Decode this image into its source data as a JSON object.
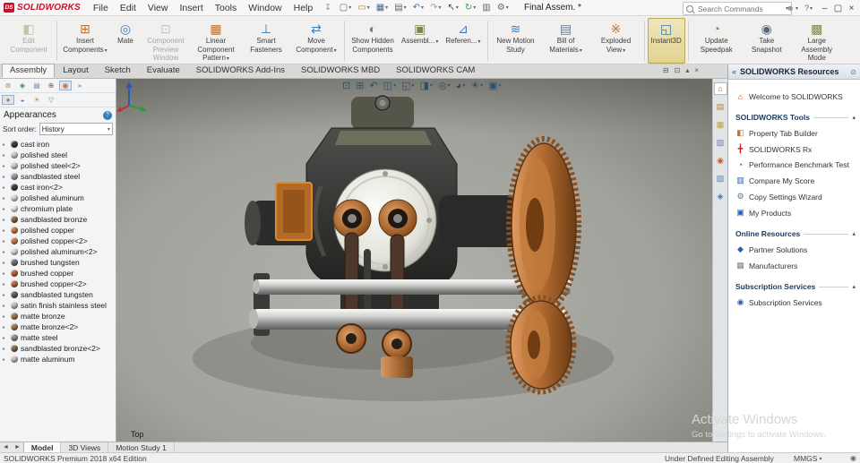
{
  "app": {
    "name": "SOLIDWORKS",
    "logo_mark": "DS",
    "document_title": "Final Assem. *"
  },
  "titlebar": {
    "menus": [
      "File",
      "Edit",
      "View",
      "Insert",
      "Tools",
      "Window",
      "Help"
    ],
    "pin_glyph": "↧",
    "quick_tools": [
      {
        "name": "new-document-icon",
        "glyph": "▢",
        "color": "#5a6a7a",
        "dropdown": true
      },
      {
        "name": "open-icon",
        "glyph": "▭",
        "color": "#b08838",
        "dropdown": true
      },
      {
        "name": "save-icon",
        "glyph": "▦",
        "color": "#4a6a9a",
        "dropdown": true
      },
      {
        "name": "print-icon",
        "glyph": "▤",
        "color": "#5a6a7a",
        "dropdown": true
      },
      {
        "name": "undo-icon",
        "glyph": "↶",
        "color": "#3a7ab8",
        "dropdown": true
      },
      {
        "name": "redo-icon",
        "glyph": "↷",
        "color": "#9aa0a6",
        "dropdown": true
      },
      {
        "name": "select-icon",
        "glyph": "↖",
        "color": "#444444",
        "dropdown": true
      },
      {
        "name": "rebuild-icon",
        "glyph": "↻",
        "color": "#3a9a4a",
        "dropdown": true
      },
      {
        "name": "file-properties-icon",
        "glyph": "▥",
        "color": "#5a6a7a"
      },
      {
        "name": "options-icon",
        "glyph": "⚙",
        "color": "#5a6a7a",
        "dropdown": true
      }
    ],
    "search": {
      "placeholder": "Search Commands"
    },
    "right_icons": [
      {
        "name": "user-icon",
        "glyph": "☻",
        "color": "#8a93a0",
        "dropdown": true
      },
      {
        "name": "help-icon",
        "glyph": "?",
        "color": "#3a7ab8",
        "dropdown": true
      }
    ],
    "window_controls": [
      {
        "name": "minimize-button",
        "glyph": "–"
      },
      {
        "name": "maximize-button",
        "glyph": "▢"
      },
      {
        "name": "close-button",
        "glyph": "×"
      }
    ]
  },
  "ribbon": {
    "buttons": [
      {
        "name": "edit-component-button",
        "icon": "edit-component-icon",
        "label": "Edit Component",
        "glyph": "◧",
        "color": "#7a8a4a",
        "disabled": true,
        "sep_after": true
      },
      {
        "name": "insert-components-button",
        "icon": "insert-components-icon",
        "label": "Insert Components",
        "glyph": "⊞",
        "color": "#b87333",
        "dropdown": true
      },
      {
        "name": "mate-button",
        "icon": "mate-icon",
        "label": "Mate",
        "glyph": "◎",
        "color": "#3a7ab8"
      },
      {
        "name": "component-preview-window-button",
        "icon": "component-preview-window-icon",
        "label": "Component Preview Window",
        "glyph": "⊡",
        "color": "#8a8a8a",
        "disabled": true
      },
      {
        "name": "linear-component-pattern-button",
        "icon": "linear-component-pattern-icon",
        "label": "Linear Component Pattern",
        "glyph": "▦",
        "color": "#b87333",
        "dropdown": true
      },
      {
        "name": "smart-fasteners-button",
        "icon": "smart-fasteners-icon",
        "label": "Smart Fasteners",
        "glyph": "⊥",
        "color": "#3a7ab8"
      },
      {
        "name": "move-component-button",
        "icon": "move-component-icon",
        "label": "Move Component",
        "glyph": "⇄",
        "color": "#3a7ab8",
        "dropdown": true,
        "sep_after": true
      },
      {
        "name": "show-hidden-components-button",
        "icon": "show-hidden-components-icon",
        "label": "Show Hidden Components",
        "glyph": "◐",
        "color": "#6a7a8a"
      },
      {
        "name": "assembly-features-button",
        "icon": "assembly-features-icon",
        "label": "Assembl...",
        "glyph": "▣",
        "color": "#7a8a4a",
        "dropdown": true
      },
      {
        "name": "reference-geometry-button",
        "icon": "reference-geometry-icon",
        "label": "Referen...",
        "glyph": "⊿",
        "color": "#3a7ab8",
        "dropdown": true,
        "sep_after": true
      },
      {
        "name": "new-motion-study-button",
        "icon": "new-motion-study-icon",
        "label": "New Motion Study",
        "glyph": "≋",
        "color": "#3a7ab8"
      },
      {
        "name": "bill-of-materials-button",
        "icon": "bill-of-materials-icon",
        "label": "Bill of Materials",
        "glyph": "▤",
        "color": "#6a7a8a",
        "dropdown": true
      },
      {
        "name": "exploded-view-button",
        "icon": "exploded-view-icon",
        "label": "Exploded View",
        "glyph": "※",
        "color": "#b87333",
        "dropdown": true,
        "sep_after": true
      },
      {
        "name": "instant3d-button",
        "icon": "instant3d-icon",
        "label": "Instant3D",
        "glyph": "◱",
        "color": "#3a7ab8",
        "highlighted": true,
        "sep_after": true
      },
      {
        "name": "update-speedpak-button",
        "icon": "update-speedpak-icon",
        "label": "Update Speedpak",
        "glyph": "◔",
        "color": "#8a8a6a"
      },
      {
        "name": "take-snapshot-button",
        "icon": "take-snapshot-icon",
        "label": "Take Snapshot",
        "glyph": "◉",
        "color": "#556677"
      },
      {
        "name": "large-assembly-mode-button",
        "icon": "large-assembly-mode-icon",
        "label": "Large Assembly Mode",
        "glyph": "▩",
        "color": "#7a8a4a"
      }
    ],
    "tabs": [
      {
        "name": "tab-assembly",
        "label": "Assembly",
        "active": true
      },
      {
        "name": "tab-layout",
        "label": "Layout"
      },
      {
        "name": "tab-sketch",
        "label": "Sketch"
      },
      {
        "name": "tab-evaluate",
        "label": "Evaluate"
      },
      {
        "name": "tab-solidworks-add-ins",
        "label": "SOLIDWORKS Add-Ins"
      },
      {
        "name": "tab-solidworks-mbd",
        "label": "SOLIDWORKS MBD"
      },
      {
        "name": "tab-solidworks-cam",
        "label": "SOLIDWORKS CAM"
      }
    ],
    "tabrow_icons": [
      {
        "name": "show-display-pane-icon",
        "glyph": "⊟"
      },
      {
        "name": "fullscreen-icon",
        "glyph": "⊡"
      },
      {
        "name": "collapse-ribbon-icon",
        "glyph": "▴"
      },
      {
        "name": "close-document-icon",
        "glyph": "×"
      }
    ]
  },
  "left_panel": {
    "manager_tabs": [
      {
        "name": "featuremanager-tree-tab-icon",
        "glyph": "⊛",
        "color": "#c08a30"
      },
      {
        "name": "propertymanager-tab-icon",
        "glyph": "◈",
        "color": "#3a8a4a"
      },
      {
        "name": "configurationmanager-tab-icon",
        "glyph": "▤",
        "color": "#7a8a9a"
      },
      {
        "name": "dimxpertmanager-tab-icon",
        "glyph": "⊕",
        "color": "#b04040"
      },
      {
        "name": "displaymanager-tab-icon",
        "glyph": "◉",
        "color": "#c87030",
        "active": true
      },
      {
        "name": "flyout-expand-icon",
        "glyph": "»",
        "color": "#667788"
      }
    ],
    "display_tabs": [
      {
        "name": "view-appearances-icon",
        "glyph": "●",
        "color": "#d07030",
        "active": true
      },
      {
        "name": "view-decals-icon",
        "glyph": "◒",
        "color": "#4a6ab0"
      },
      {
        "name": "view-scene-lights-icon",
        "glyph": "☀",
        "color": "#c0a020"
      },
      {
        "name": "filter-icon",
        "glyph": "▽",
        "color": "#888899"
      }
    ],
    "title": "Appearances",
    "sort_label": "Sort order:",
    "sort_value": "History",
    "materials": [
      {
        "label": "cast iron",
        "color": "#3f3f3f"
      },
      {
        "label": "polished steel",
        "color": "#c9ccd0"
      },
      {
        "label": "polished steel<2>",
        "color": "#c9ccd0"
      },
      {
        "label": "sandblasted steel",
        "color": "#9aa0a6"
      },
      {
        "label": "cast iron<2>",
        "color": "#3f3f3f"
      },
      {
        "label": "polished aluminum",
        "color": "#d6d8da"
      },
      {
        "label": "chromium plate",
        "color": "#e4e6ea"
      },
      {
        "label": "sandblasted bronze",
        "color": "#8a6a48"
      },
      {
        "label": "polished copper",
        "color": "#c97a45"
      },
      {
        "label": "polished copper<2>",
        "color": "#c97a45"
      },
      {
        "label": "polished aluminum<2>",
        "color": "#d6d8da"
      },
      {
        "label": "brushed tungsten",
        "color": "#6e7074"
      },
      {
        "label": "brushed copper",
        "color": "#b8663a"
      },
      {
        "label": "brushed copper<2>",
        "color": "#b8663a"
      },
      {
        "label": "sandblasted tungsten",
        "color": "#5c5e62"
      },
      {
        "label": "satin finish stainless steel",
        "color": "#bcc0c4"
      },
      {
        "label": "matte bronze",
        "color": "#a07a4e"
      },
      {
        "label": "matte bronze<2>",
        "color": "#a07a4e"
      },
      {
        "label": "matte steel",
        "color": "#8d9093"
      },
      {
        "label": "sandblasted bronze<2>",
        "color": "#8a6a48"
      },
      {
        "label": "matte aluminum",
        "color": "#c4c6c8"
      }
    ]
  },
  "viewport": {
    "headsup_icons": [
      {
        "name": "zoom-fit-icon",
        "glyph": "⊡"
      },
      {
        "name": "zoom-area-icon",
        "glyph": "⊞"
      },
      {
        "name": "previous-view-icon",
        "glyph": "↶"
      },
      {
        "name": "section-view-icon",
        "glyph": "◫",
        "dropdown": true
      },
      {
        "name": "view-orientation-icon",
        "glyph": "◱",
        "dropdown": true
      },
      {
        "name": "display-style-icon",
        "glyph": "◨",
        "dropdown": true
      },
      {
        "name": "hide-show-items-icon",
        "glyph": "◎",
        "dropdown": true
      },
      {
        "name": "edit-appearance-icon",
        "glyph": "◕",
        "dropdown": true
      },
      {
        "name": "scene-icon",
        "glyph": "☀",
        "dropdown": true
      },
      {
        "name": "view-settings-icon",
        "glyph": "▣",
        "dropdown": true
      }
    ],
    "view_label": "Top",
    "watermark": {
      "line1": "Activate Windows",
      "line2": "Go to Settings to activate Windows."
    }
  },
  "task_pane": {
    "tabs": [
      {
        "name": "solidworks-resources-tab-icon",
        "glyph": "⌂",
        "color": "#c05020",
        "active": true
      },
      {
        "name": "design-library-tab-icon",
        "glyph": "▤",
        "color": "#b08030"
      },
      {
        "name": "file-explorer-tab-icon",
        "glyph": "▦",
        "color": "#c0a040"
      },
      {
        "name": "view-palette-tab-icon",
        "glyph": "▧",
        "color": "#7080b0"
      },
      {
        "name": "appearances-scenes-tab-icon",
        "glyph": "◉",
        "color": "#c06030"
      },
      {
        "name": "custom-properties-tab-icon",
        "glyph": "▨",
        "color": "#6080a0"
      },
      {
        "name": "solidworks-forum-tab-icon",
        "glyph": "◈",
        "color": "#4070b0"
      }
    ],
    "title": "SOLIDWORKS Resources",
    "welcome": {
      "label": "Welcome to SOLIDWORKS",
      "glyph": "⌂",
      "color": "#c04020"
    },
    "sections": [
      {
        "title": "SOLIDWORKS Tools",
        "items": [
          {
            "name": "property-tab-builder-link",
            "label": "Property Tab Builder",
            "glyph": "◧",
            "color": "#d07020"
          },
          {
            "name": "solidworks-rx-link",
            "label": "SOLIDWORKS Rx",
            "glyph": "╋",
            "color": "#cc2020"
          },
          {
            "name": "performance-benchmark-test-link",
            "label": "Performance Benchmark Test",
            "glyph": "◔",
            "color": "#cc2020"
          },
          {
            "name": "compare-my-score-link",
            "label": "Compare My Score",
            "glyph": "▥",
            "color": "#2060b0"
          },
          {
            "name": "copy-settings-wizard-link",
            "label": "Copy Settings Wizard",
            "glyph": "⚙",
            "color": "#607890"
          },
          {
            "name": "my-products-link",
            "label": "My Products",
            "glyph": "▣",
            "color": "#2060b0"
          }
        ]
      },
      {
        "title": "Online Resources",
        "items": [
          {
            "name": "partner-solutions-link",
            "label": "Partner Solutions",
            "glyph": "◆",
            "color": "#2060b0"
          },
          {
            "name": "manufacturers-link",
            "label": "Manufacturers",
            "glyph": "▦",
            "color": "#708090"
          }
        ]
      },
      {
        "title": "Subscription Services",
        "items": [
          {
            "name": "subscription-services-link",
            "label": "Subscription Services",
            "glyph": "◉",
            "color": "#2060b0"
          }
        ]
      }
    ]
  },
  "bottom_bar": {
    "nav_icons": [
      {
        "name": "tab-scroll-left-icon",
        "glyph": "◄"
      },
      {
        "name": "tab-scroll-right-icon",
        "glyph": "►"
      }
    ],
    "tabs": [
      {
        "name": "tab-model",
        "label": "Model",
        "active": true
      },
      {
        "name": "tab-3d-views",
        "label": "3D Views"
      },
      {
        "name": "tab-motion-study-1",
        "label": "Motion Study 1"
      }
    ]
  },
  "status_bar": {
    "left_text": "SOLIDWORKS Premium 2018 x64 Edition",
    "state": "Under Defined",
    "mode": "Editing Assembly",
    "units": "MMGS"
  }
}
